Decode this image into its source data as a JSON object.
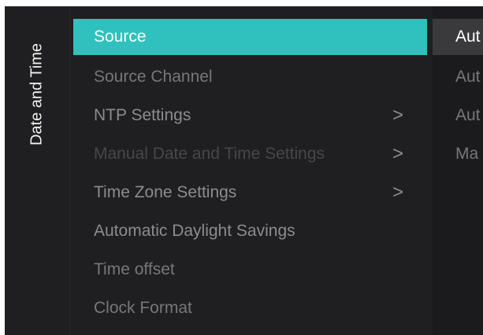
{
  "side": {
    "title": "Date and Time"
  },
  "menu": {
    "items": [
      {
        "label": "Source"
      },
      {
        "label": "Source Channel"
      },
      {
        "label": "NTP Settings"
      },
      {
        "label": "Manual Date and Time Settings"
      },
      {
        "label": "Time Zone Settings"
      },
      {
        "label": "Automatic Daylight Savings"
      },
      {
        "label": "Time offset"
      },
      {
        "label": "Clock Format"
      }
    ],
    "chevron": ">"
  },
  "submenu": {
    "items": [
      {
        "label": "Aut"
      },
      {
        "label": "Aut"
      },
      {
        "label": "Aut"
      },
      {
        "label": "Ma"
      }
    ]
  },
  "colors": {
    "accent": "#30c0bd",
    "background": "#1f1f21"
  }
}
